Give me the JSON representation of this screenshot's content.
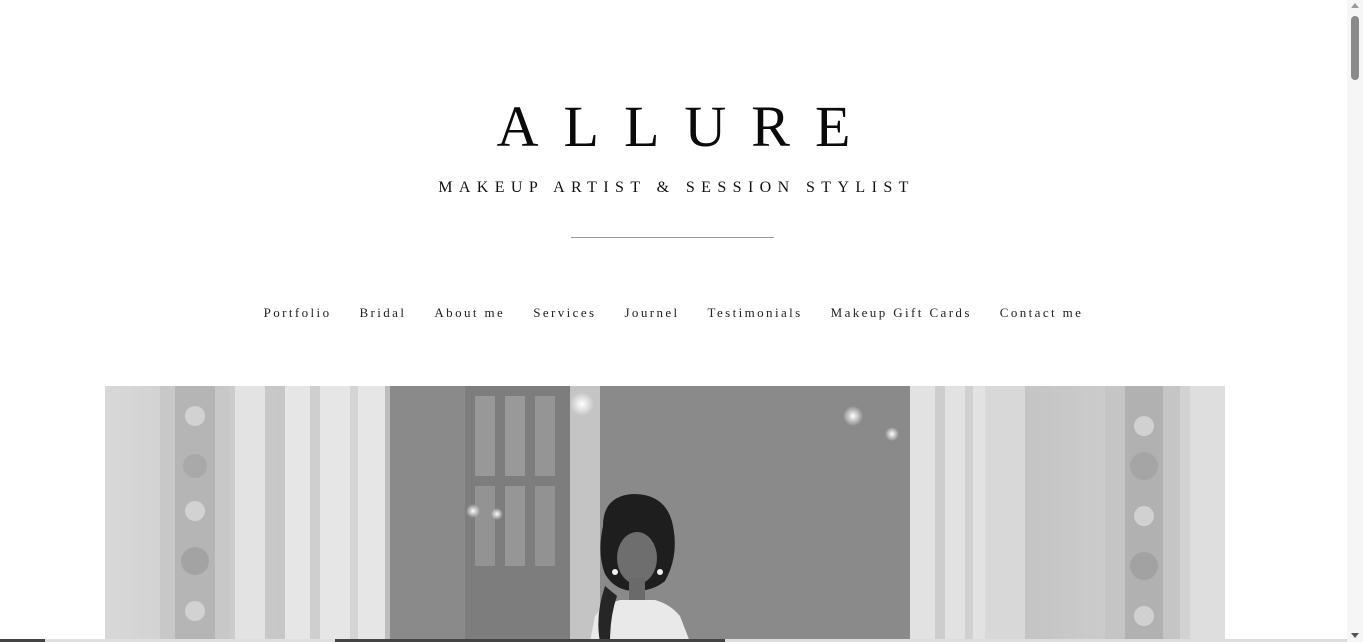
{
  "header": {
    "site_title": "ALLURE",
    "tagline": "MAKEUP ARTIST & SESSION STYLIST"
  },
  "nav": {
    "items": [
      {
        "label": "Portfolio"
      },
      {
        "label": "Bridal"
      },
      {
        "label": "About me"
      },
      {
        "label": "Services"
      },
      {
        "label": "Journel"
      },
      {
        "label": "Testimonials"
      },
      {
        "label": "Makeup Gift Cards"
      },
      {
        "label": "Contact me"
      }
    ]
  },
  "hero": {
    "image_tone": "grayscale"
  },
  "colors": {
    "background": "#ffffff",
    "text": "#111111",
    "divider": "#9a9a9a"
  }
}
